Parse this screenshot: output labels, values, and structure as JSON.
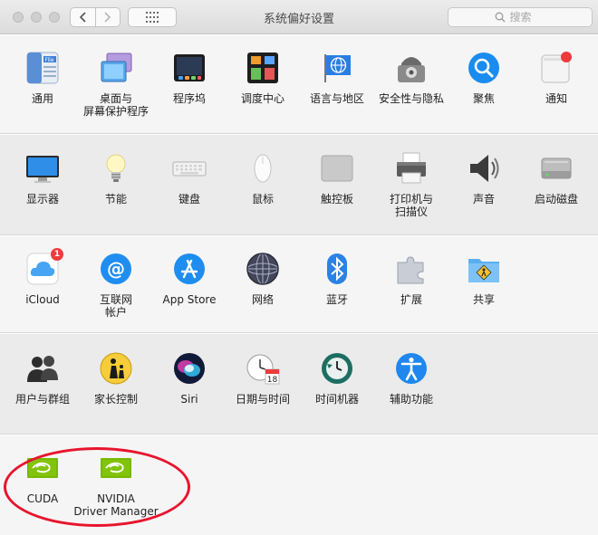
{
  "window": {
    "title": "系统偏好设置",
    "search_placeholder": "搜索"
  },
  "sections": [
    {
      "panes": [
        {
          "label": "通用",
          "icon": "general-icon"
        },
        {
          "label": "桌面与\n屏幕保护程序",
          "icon": "desktop-screensaver-icon"
        },
        {
          "label": "程序坞",
          "icon": "dock-icon"
        },
        {
          "label": "调度中心",
          "icon": "mission-control-icon"
        },
        {
          "label": "语言与地区",
          "icon": "language-region-icon"
        },
        {
          "label": "安全性与隐私",
          "icon": "security-privacy-icon"
        },
        {
          "label": "聚焦",
          "icon": "spotlight-icon"
        },
        {
          "label": "通知",
          "icon": "notifications-icon"
        }
      ]
    },
    {
      "panes": [
        {
          "label": "显示器",
          "icon": "displays-icon"
        },
        {
          "label": "节能",
          "icon": "energy-saver-icon"
        },
        {
          "label": "键盘",
          "icon": "keyboard-icon"
        },
        {
          "label": "鼠标",
          "icon": "mouse-icon"
        },
        {
          "label": "触控板",
          "icon": "trackpad-icon"
        },
        {
          "label": "打印机与\n扫描仪",
          "icon": "printers-scanners-icon"
        },
        {
          "label": "声音",
          "icon": "sound-icon"
        },
        {
          "label": "启动磁盘",
          "icon": "startup-disk-icon"
        }
      ]
    },
    {
      "panes": [
        {
          "label": "iCloud",
          "icon": "icloud-icon",
          "badge": "1"
        },
        {
          "label": "互联网\n帐户",
          "icon": "internet-accounts-icon"
        },
        {
          "label": "App Store",
          "icon": "app-store-icon"
        },
        {
          "label": "网络",
          "icon": "network-icon"
        },
        {
          "label": "蓝牙",
          "icon": "bluetooth-icon"
        },
        {
          "label": "扩展",
          "icon": "extensions-icon"
        },
        {
          "label": "共享",
          "icon": "sharing-icon"
        }
      ]
    },
    {
      "panes": [
        {
          "label": "用户与群组",
          "icon": "users-groups-icon"
        },
        {
          "label": "家长控制",
          "icon": "parental-controls-icon"
        },
        {
          "label": "Siri",
          "icon": "siri-icon"
        },
        {
          "label": "日期与时间",
          "icon": "date-time-icon"
        },
        {
          "label": "时间机器",
          "icon": "time-machine-icon"
        },
        {
          "label": "辅助功能",
          "icon": "accessibility-icon"
        }
      ]
    },
    {
      "panes": [
        {
          "label": "CUDA",
          "icon": "nvidia-cuda-icon"
        },
        {
          "label": "NVIDIA\nDriver Manager",
          "icon": "nvidia-driver-manager-icon"
        }
      ]
    }
  ],
  "calendar_icon_day": "18",
  "colors": {
    "annotation": "#e8142e",
    "nvidia_green": "#76b900",
    "badge_red": "#ee3b3b"
  }
}
